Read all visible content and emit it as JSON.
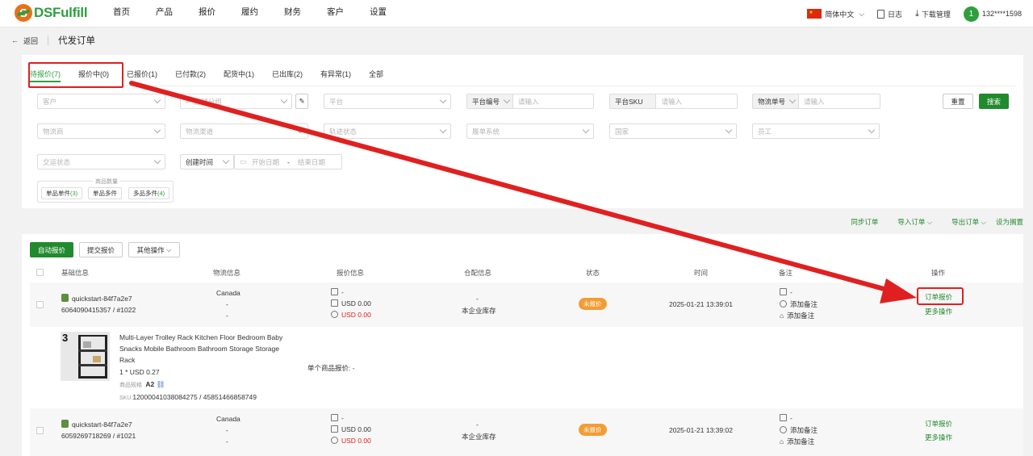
{
  "brand": {
    "name": "DSFulfill",
    "mark": "S",
    "accent": "#2e9f3e",
    "orange": "#e8701a"
  },
  "nav": [
    "首页",
    "产品",
    "报价",
    "履约",
    "财务",
    "客户",
    "设置"
  ],
  "top_right": {
    "language": "简体中文",
    "log": "日志",
    "download": "下载管理",
    "user": "132****1598",
    "avatar": "1"
  },
  "breadcrumb": {
    "back": "返回",
    "title": "代发订单"
  },
  "tabs": [
    "待报价(7)",
    "报价中(0)",
    "已报价(1)",
    "已付款(2)",
    "配货中(1)",
    "已出库(2)",
    "有异常(1)",
    "全部"
  ],
  "filters": {
    "customer": "客户",
    "store_group": "店铺分组",
    "platform": "平台",
    "platform_no_label": "平台编号",
    "platform_no_ph": "请输入",
    "platform_sku_label": "平台SKU",
    "platform_sku_ph": "请输入",
    "tracking_label": "物流单号",
    "tracking_ph": "请输入",
    "reset": "重置",
    "search": "搜索",
    "carrier": "物流商",
    "channel": "物流渠道",
    "track_status": "轨迹状态",
    "bill_system": "履单系统",
    "country": "国家",
    "staff": "员工",
    "ship_status": "交运状态",
    "time_type": "创建时间",
    "start_date": "开始日期",
    "date_sep": "-",
    "end_date": "结束日期",
    "qty_label": "商品数量",
    "qty_single_single": "单品单件",
    "qty_single_single_n": "(3)",
    "qty_single_multi": "单品多件",
    "qty_multi_multi": "多品多件",
    "qty_multi_multi_n": "(4)"
  },
  "actions": [
    "同步订单",
    "导入订单",
    "导出订单",
    "设为搁置"
  ],
  "toolbar": {
    "auto_quote": "自动报价",
    "submit_quote": "提交报价",
    "more_ops": "其他操作"
  },
  "columns": [
    "基础信息",
    "物流信息",
    "报价信息",
    "仓配信息",
    "状态",
    "时间",
    "备注",
    "操作"
  ],
  "orders": [
    {
      "store": "quickstart-84f7a2e7",
      "ids": "6064090415357 / #1022",
      "country": "Canada",
      "ship1": "-",
      "ship2": "-",
      "q1": "-",
      "q2": "USD 0.00",
      "q3": "USD 0.00",
      "wh1": "-",
      "wh2": "本企业库存",
      "status": "未报价",
      "time": "2025-01-21 13:39:01",
      "note1": "-",
      "note2": "添加备注",
      "note3": "添加备注",
      "op1": "订单报价",
      "op2": "更多操作",
      "item": {
        "title_l1": "Multi-Layer Trolley Rack Kitchen Floor Bedroom Baby",
        "title_l2": "Snacks Mobile Bathroom Bathroom Storage Storage",
        "title_l3": "Rack",
        "qty_price": "1 * USD 0.27",
        "spec_label": "商品规格",
        "spec": "A2",
        "sku_label": "SKU:",
        "sku": "12000041038084275 / 45851466858749",
        "unit_quote": "单个商品报价:  -",
        "thumb_num": "3"
      }
    },
    {
      "store": "quickstart-84f7a2e7",
      "ids": "6059269718269 / #1021",
      "country": "Canada",
      "ship1": "-",
      "ship2": "-",
      "q1": "-",
      "q2": "USD 0.00",
      "q3": "USD 0.00",
      "wh1": "-",
      "wh2": "本企业库存",
      "status": "未报价",
      "time": "2025-01-21 13:39:02",
      "note1": "-",
      "note2": "添加备注",
      "note3": "添加备注",
      "op1": "订单报价",
      "op2": "更多操作"
    }
  ]
}
